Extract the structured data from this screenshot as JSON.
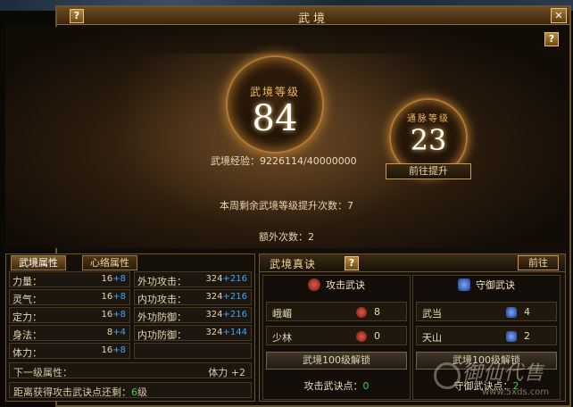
{
  "window": {
    "title": "武境"
  },
  "stage": {
    "level_label": "武境等级",
    "level_value": "84",
    "meridian_label": "通脉等级",
    "meridian_value": "23",
    "exp_label": "武境经验：",
    "exp_value": "9226114/40000000",
    "goto_upgrade": "前往提升",
    "weekly_text": "本周剩余武境等级提升次数：7",
    "extra_text": "额外次数：2"
  },
  "attributes": {
    "tabs": [
      "武境属性",
      "心络属性"
    ],
    "rows_left": [
      {
        "name": "力量：",
        "base": "16",
        "bonus": "+8"
      },
      {
        "name": "灵气：",
        "base": "16",
        "bonus": "+8"
      },
      {
        "name": "定力：",
        "base": "16",
        "bonus": "+8"
      },
      {
        "name": "身法：",
        "base": "8",
        "bonus": "+4"
      },
      {
        "name": "体力：",
        "base": "16",
        "bonus": "+8"
      }
    ],
    "rows_right": [
      {
        "name": "外功攻击：",
        "base": "324",
        "bonus": "+216"
      },
      {
        "name": "内功攻击：",
        "base": "324",
        "bonus": "+216"
      },
      {
        "name": "外功防御：",
        "base": "324",
        "bonus": "+216"
      },
      {
        "name": "内功防御：",
        "base": "324",
        "bonus": "+144"
      }
    ],
    "next_label": "下一级属性：",
    "next_value": "体力 +2",
    "distance_prefix": "距离获得攻击武诀点还剩：",
    "distance_value": "6",
    "distance_suffix": "级"
  },
  "skills": {
    "panel_title": "武境真诀",
    "goto": "前往",
    "attack": {
      "title": "攻击武诀",
      "items": [
        {
          "name": "峨嵋",
          "value": "8"
        },
        {
          "name": "少林",
          "value": "0"
        }
      ],
      "unlock": "武境100级解锁",
      "points_label": "攻击武诀点：",
      "points_value": "0"
    },
    "defense": {
      "title": "守御武诀",
      "items": [
        {
          "name": "武当",
          "value": "4"
        },
        {
          "name": "天山",
          "value": "2"
        }
      ],
      "unlock": "武境100级解锁",
      "points_label": "守御武诀点：",
      "points_value": "2"
    }
  },
  "colors": {
    "gold": "#f0b85a",
    "bonus_blue": "#38a6ff",
    "green": "#3dd03d"
  },
  "watermark": {
    "text": "御仙代售",
    "url": "www.5xds.com"
  }
}
